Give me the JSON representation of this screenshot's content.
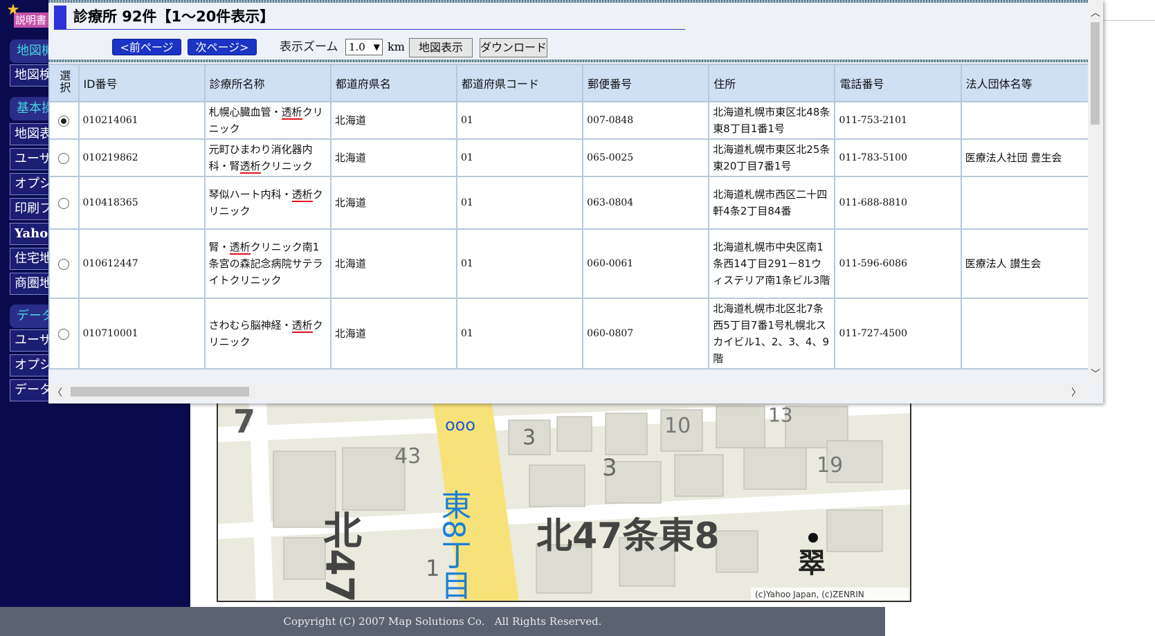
{
  "sidebar": {
    "sections": [
      "地図機",
      "基本操",
      "データ"
    ],
    "items": [
      "地図検",
      "地図表",
      "ユーザ",
      "オプシ",
      "印刷フ",
      "Yahoo",
      "住宅地",
      "商圏地",
      "ユーザ",
      "オプシ",
      "データ"
    ],
    "top_strip": "説明書"
  },
  "map": {
    "labels": {
      "block_7": "7",
      "subway_icon": "ooo",
      "num_3a": "3",
      "num_10": "10",
      "num_13": "13",
      "num_43": "43",
      "num_3b": "3",
      "num_19": "19",
      "road_vertical": "東8丁目",
      "kita47": "北47",
      "num_1": "1",
      "area_name": "北47条東8",
      "kanji_bottom": "翠",
      "copyright": "(c)Yahoo Japan, (c)ZENRIN"
    }
  },
  "footer": {
    "text": "Copyright (C) 2007 Map Solutions Co.   All Rights Reserved."
  },
  "popup": {
    "title": "診療所 92件【1～20件表示】",
    "prev_button": "<前ページ",
    "next_button": "次ページ>",
    "zoom_label": "表示ズーム",
    "zoom_value": "1.0",
    "zoom_unit": "km",
    "map_button": "地図表示",
    "download_button": "ダウンロード",
    "table": {
      "headers": [
        "選択",
        "ID番号",
        "診療所名称",
        "都道府県名",
        "都道府県コード",
        "郵便番号",
        "住所",
        "電話番号",
        "法人団体名等"
      ],
      "rows": [
        {
          "selected": true,
          "id": "010214061",
          "name_pre": "札幌心臓血管・",
          "name_hl": "透析",
          "name_post": "クリニック",
          "pref": "北海道",
          "code": "01",
          "zip": "007-0848",
          "address": "北海道札幌市東区北48条東8丁目1番1号",
          "phone": "011-753-2101",
          "corp": ""
        },
        {
          "selected": false,
          "id": "010219862",
          "name_pre": "元町ひまわり消化器内科・腎",
          "name_hl": "透析",
          "name_post": "クリニック",
          "pref": "北海道",
          "code": "01",
          "zip": "065-0025",
          "address": "北海道札幌市東区北25条東20丁目7番1号",
          "phone": "011-783-5100",
          "corp": "医療法人社団 豊生会"
        },
        {
          "selected": false,
          "id": "010418365",
          "name_pre": "琴似ハート内科・",
          "name_hl": "透析",
          "name_post": "クリニック",
          "pref": "北海道",
          "code": "01",
          "zip": "063-0804",
          "address": "北海道札幌市西区二十四軒4条2丁目84番",
          "phone": "011-688-8810",
          "corp": ""
        },
        {
          "selected": false,
          "id": "010612447",
          "name_pre": "腎・",
          "name_hl": "透析",
          "name_post": "クリニック南1条宮の森記念病院サテライトクリニック",
          "pref": "北海道",
          "code": "01",
          "zip": "060-0061",
          "address": "北海道札幌市中央区南1条西14丁目291－81ウィステリア南1条ビル3階",
          "phone": "011-596-6086",
          "corp": "医療法人 讃生会"
        },
        {
          "selected": false,
          "id": "010710001",
          "name_pre": "さわむら脳神経・",
          "name_hl": "透析",
          "name_post": "クリニック",
          "pref": "北海道",
          "code": "01",
          "zip": "060-0807",
          "address": "北海道札幌市北区北7条西5丁目7番1号札幌北スカイビル1、2、3、4、9階",
          "phone": "011-727-4500",
          "corp": ""
        }
      ]
    }
  }
}
